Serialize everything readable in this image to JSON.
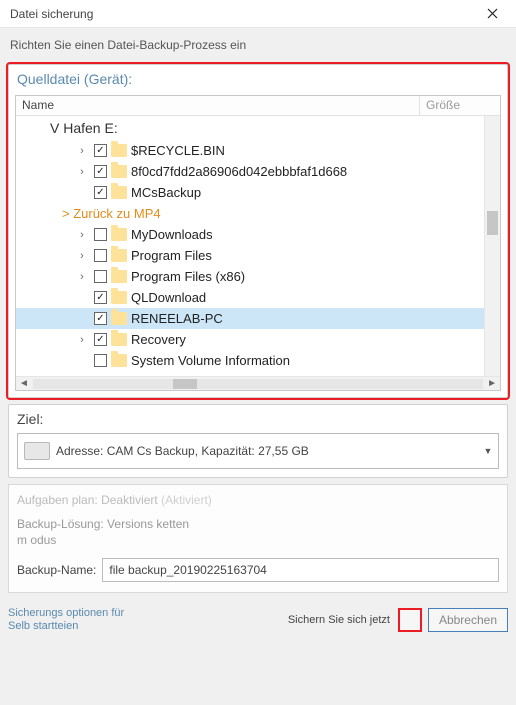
{
  "window": {
    "title": "Datei sicherung"
  },
  "subheader": "Richten Sie einen Datei-Backup-Prozess ein",
  "source": {
    "title": "Quelldatei (Gerät):",
    "columns": {
      "name": "Name",
      "size": "Größe"
    },
    "drive": "V Hafen E:",
    "back": "> Zurück zu MP4",
    "rows": [
      {
        "label": "$RECYCLE.BIN",
        "expander": true,
        "checked": true,
        "selected": false
      },
      {
        "label": "8f0cd7fdd2a86906d042ebbbfaf1d668",
        "expander": true,
        "checked": true,
        "selected": false
      },
      {
        "label": "MCsBackup",
        "expander": false,
        "checked": true,
        "selected": false
      },
      {
        "label": "MyDownloads",
        "expander": true,
        "checked": false,
        "selected": false
      },
      {
        "label": "Program Files",
        "expander": true,
        "checked": false,
        "selected": false
      },
      {
        "label": "Program Files (x86)",
        "expander": true,
        "checked": false,
        "selected": false
      },
      {
        "label": "QLDownload",
        "expander": false,
        "checked": true,
        "selected": false
      },
      {
        "label": "RENEELAB-PC",
        "expander": false,
        "checked": true,
        "selected": true
      },
      {
        "label": "Recovery",
        "expander": true,
        "checked": true,
        "selected": false
      },
      {
        "label": "System Volume Information",
        "expander": false,
        "checked": false,
        "selected": false
      }
    ]
  },
  "dest": {
    "title": "Ziel:",
    "text": "Adresse: CAM Cs Backup, Kapazität: 27,55 GB"
  },
  "info": {
    "schedule_prefix": "Aufgaben plan: ",
    "schedule_status": "Deaktiviert",
    "schedule_action": "(Aktiviert)",
    "solution": "Backup-Lösung: Versions ketten m odus",
    "name_label": "Backup-Name:",
    "name_value": "file backup_20190225163704"
  },
  "footer": {
    "self_options": "Sicherungs optionen für Selb startteien",
    "save_label": "Sichern Sie sich jetzt",
    "cancel_label": "Abbrechen"
  }
}
